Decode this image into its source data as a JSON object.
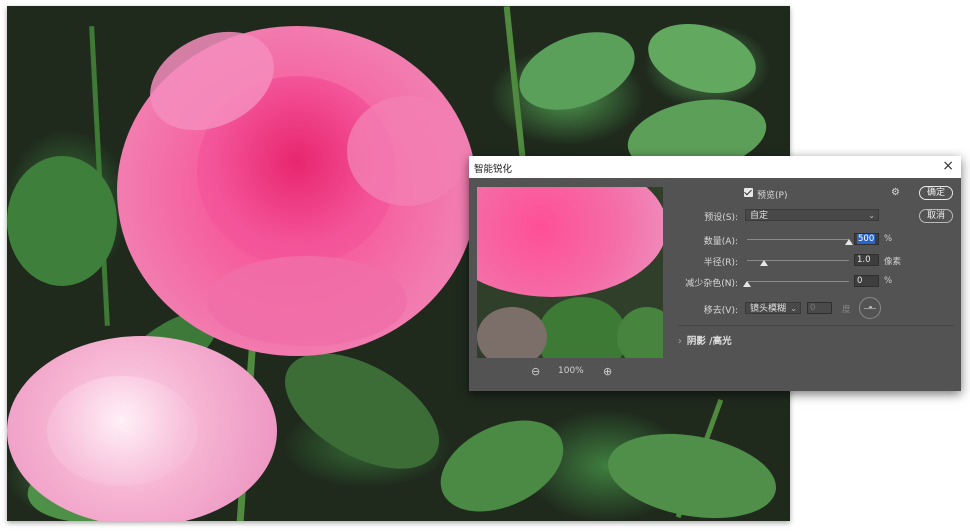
{
  "dialog": {
    "title": "智能锐化",
    "close_glyph": "×",
    "preview_label": "预览(P)",
    "preview_checked": true,
    "preset_label": "预设(S):",
    "preset_value": "自定",
    "amount": {
      "label": "数量(A):",
      "value": "500",
      "unit": "%",
      "fraction": 1.0
    },
    "radius": {
      "label": "半径(R):",
      "value": "1.0",
      "unit": "像素",
      "fraction": 0.17
    },
    "noise": {
      "label": "减少杂色(N):",
      "value": "0",
      "unit": "%",
      "fraction": 0.0
    },
    "remove": {
      "label": "移去(V):",
      "value": "镜头模糊",
      "angle_value": "0",
      "angle_unit": "度"
    },
    "ok_button": "确定",
    "cancel_button": "取消",
    "shadow_highlight": "阴影 /高光",
    "zoom_level": "100%",
    "icons": {
      "gear": "gear-icon",
      "zoom_out": "zoom-out-icon",
      "zoom_in": "zoom-in-icon",
      "chevron": "chevron-down-icon",
      "expand": "chevron-right-icon",
      "angle": "angle-wheel-icon"
    }
  },
  "colors": {
    "dialog_bg": "#535353",
    "accent_selection": "#2a64c8",
    "rose_pink": "#f06aa0",
    "leaf_green": "#4f8a3f"
  }
}
